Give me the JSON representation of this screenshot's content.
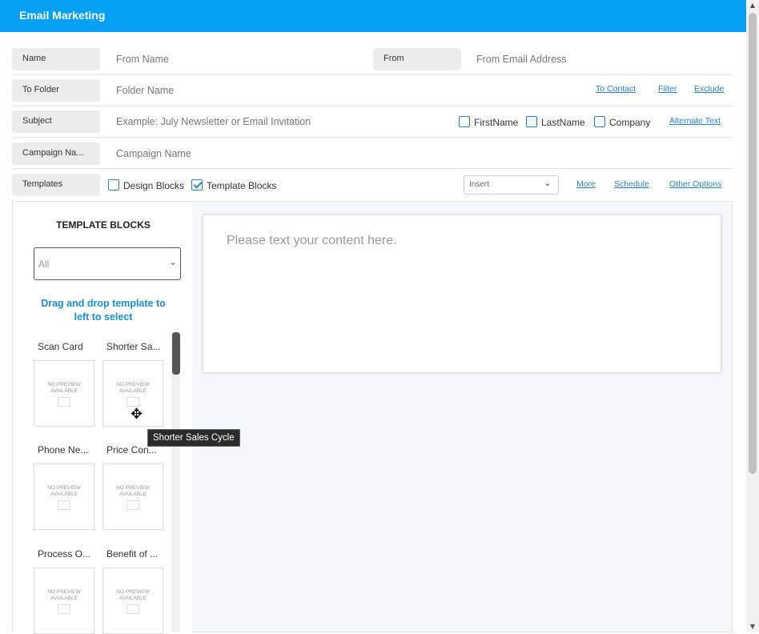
{
  "header": {
    "title": "Email Marketing"
  },
  "form": {
    "name": {
      "label": "Name",
      "placeholder": "From Name"
    },
    "from": {
      "label": "From",
      "placeholder": "From Email Address"
    },
    "to_folder": {
      "label": "To Folder",
      "placeholder": "Folder Name",
      "links": [
        "To Contact",
        "Filter",
        "Exclude"
      ]
    },
    "subject": {
      "label": "Subject",
      "placeholder": "Example: July Newsletter or Email Invitation",
      "checkboxes": [
        {
          "label": "FirstName",
          "checked": false
        },
        {
          "label": "LastName",
          "checked": false
        },
        {
          "label": "Company",
          "checked": false
        }
      ],
      "alternate_text_link": "Alternate Text"
    },
    "campaign": {
      "label": "Campaign Na...",
      "placeholder": "Campaign Name"
    },
    "templates": {
      "label": "Templates",
      "design_blocks": {
        "label": "Design Blocks",
        "checked": false
      },
      "template_blocks": {
        "label": "Template Blocks",
        "checked": true
      },
      "insert_select": "Insert",
      "links": [
        "More",
        "Schedule",
        "Other Options"
      ]
    }
  },
  "sidebar": {
    "title": "TEMPLATE BLOCKS",
    "filter_value": "All",
    "help": "Drag and drop template to left to select",
    "no_preview": "NO PREVIEW AVAILABLE",
    "templates": [
      {
        "name": "Scan Card"
      },
      {
        "name": "Shorter Sa..."
      },
      {
        "name": "Phone Ne..."
      },
      {
        "name": "Price Con..."
      },
      {
        "name": "Process O..."
      },
      {
        "name": "Benefit of ..."
      }
    ]
  },
  "editor": {
    "placeholder": "Please text your content here."
  },
  "tooltip": {
    "text": "Shorter Sales Cycle"
  },
  "colors": {
    "header": "#03a0f4",
    "link": "#2a7fc1",
    "help_text": "#1a8fd6"
  }
}
